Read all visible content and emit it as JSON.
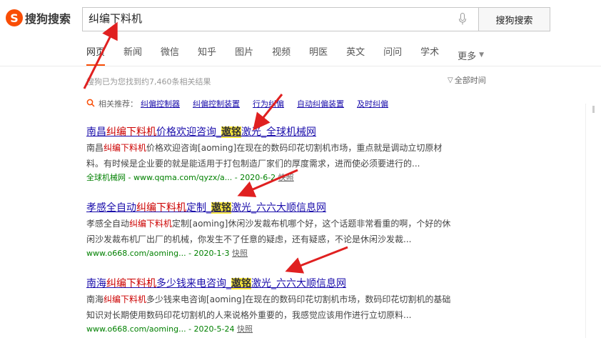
{
  "logo": {
    "mark": "S",
    "text": "搜狗搜索"
  },
  "search": {
    "query": "纠编下料机",
    "button": "搜狗搜索"
  },
  "tabs": [
    {
      "label": "网页",
      "active": true
    },
    {
      "label": "新闻"
    },
    {
      "label": "微信"
    },
    {
      "label": "知乎"
    },
    {
      "label": "图片"
    },
    {
      "label": "视频"
    },
    {
      "label": "明医"
    },
    {
      "label": "英文"
    },
    {
      "label": "问问"
    },
    {
      "label": "学术"
    },
    {
      "label": "更多"
    }
  ],
  "result_count": "搜狗已为您找到约7,460条相关结果",
  "time_filter": "全部时间",
  "related": {
    "label": "相关推荐：",
    "items": [
      "纠偏控制器",
      "纠偏控制装置",
      "行为纠偏",
      "自动纠偏装置",
      "及时纠偏"
    ]
  },
  "results": [
    {
      "title_parts": [
        "南昌",
        "纠编下料机",
        "价格欢迎咨询_",
        "遨铭",
        "激光_全球机械网"
      ],
      "snippet_line1_parts": [
        "南昌",
        "纠编下料机",
        "价格欢迎咨询[aoming]在现在的数码印花切割机市场，重点就是调动立切原材"
      ],
      "snippet_line2": "料。有时候是企业要的就是能适用于打包制造厂家们的厚度需求，进而使必须要进行的...",
      "url": "全球机械网 - www.qqma.com/qyzx/a...",
      "date": "- 2020-6-2",
      "snapshot": "快照"
    },
    {
      "title_parts": [
        "孝感全自动",
        "纠编下料机",
        "定制_",
        "遨铭",
        "激光_六六大顺信息网"
      ],
      "snippet_line1_parts": [
        "孝感全自动",
        "纠编下料机",
        "定制[aoming]休闲沙发裁布机哪个好，这个话题非常看重的啊，个好的休"
      ],
      "snippet_line2": "闲沙发裁布机厂出厂的机械，你发生不了任意的疑虑，还有疑惑，不论是休闲沙发裁...",
      "url": "www.o668.com/aoming...",
      "date": "- 2020-1-3",
      "snapshot": "快照"
    },
    {
      "title_parts": [
        "南海",
        "纠编下料机",
        "多少钱来电咨询_",
        "遨铭",
        "激光_六六大顺信息网"
      ],
      "snippet_line1_parts": [
        "南海",
        "纠编下料机",
        "多少钱来电咨询[aoming]在现在的数码印花切割机市场，数码印花切割机的基础"
      ],
      "snippet_line2": "知识对长期使用数码印花切割机的人来说格外重要的，我感觉应该用作进行立切原料...",
      "url": "www.o668.com/aoming...",
      "date": "- 2020-5-24",
      "snapshot": "快照"
    }
  ],
  "colors": {
    "accent": "#f94d05",
    "link": "#1a0dab",
    "highlight": "#ffeb3b",
    "url_green": "#008000",
    "arrow_red": "#e02020"
  },
  "icons": [
    "microphone-icon",
    "funnel-icon",
    "magnifier-icon",
    "chevron-down-icon"
  ]
}
